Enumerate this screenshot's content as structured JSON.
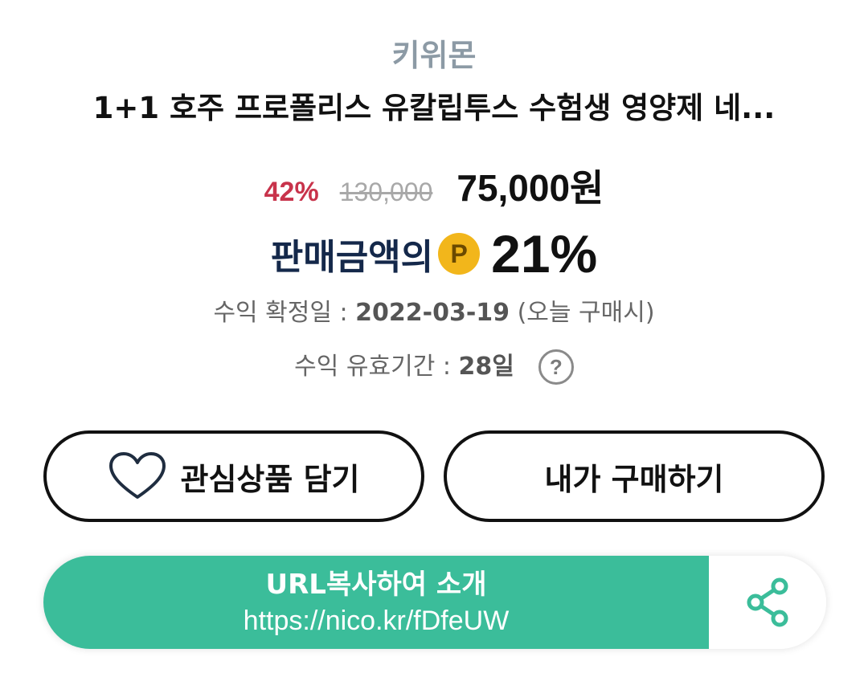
{
  "product": {
    "seller": "키위몬",
    "title": "1+1 호주 프로폴리스 유칼립투스 수험생 영양제 네...",
    "discount": "42%",
    "original_price": "130,000",
    "sale_price": "75,000원"
  },
  "reward": {
    "label": "판매금액의",
    "badge": "P",
    "percent": "21%"
  },
  "info": {
    "confirm_label": "수익 확정일 : ",
    "confirm_date": "2022-03-19",
    "confirm_note": " (오늘 구매시)",
    "valid_label": "수익 유효기간 : ",
    "valid_value": "28일",
    "help": "?"
  },
  "buttons": {
    "wishlist": "관심상품 담기",
    "buy": "내가 구매하기"
  },
  "share": {
    "copy_label": "URL복사하여 소개",
    "url": "https://nico.kr/fDfeUW"
  },
  "colors": {
    "accent": "#3bbd9a",
    "discount": "#c8334b",
    "badge": "#f2b61b",
    "reward_text": "#14284a"
  },
  "icons": {
    "heart": "heart-icon",
    "help": "question-icon",
    "share": "share-icon"
  }
}
